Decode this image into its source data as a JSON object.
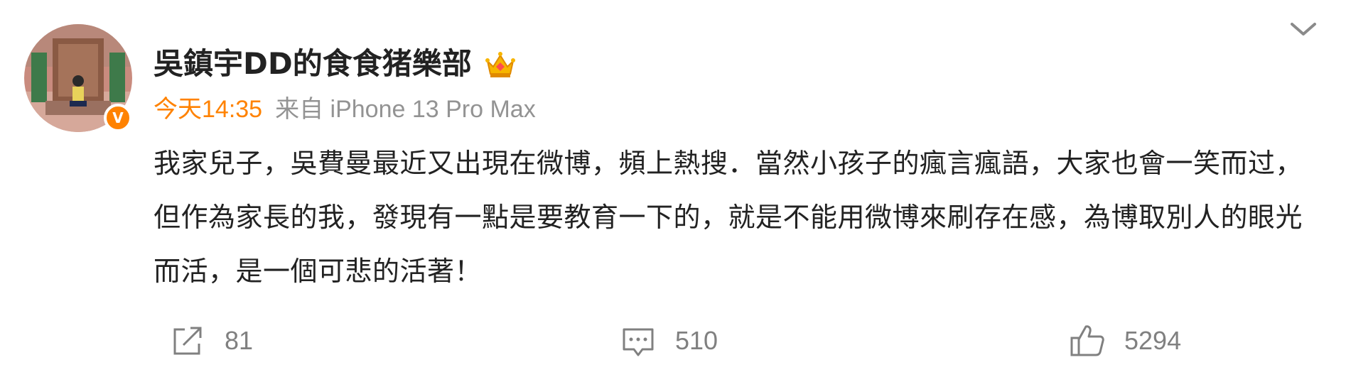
{
  "post": {
    "username": "吳鎮宇DD的食食猪樂部",
    "time": "今天14:35",
    "source": "来自 iPhone 13 Pro Max",
    "content": "我家兒子，吳費曼最近又出現在微博，頻上熱搜．當然小孩子的瘋言瘋語，大家也會一笑而过，但作為家長的我，發現有一點是要教育一下的，就是不能用微博來刷存在感，為博取別人的眼光而活，是一個可悲的活著！",
    "verified_mark": "V"
  },
  "actions": {
    "repost_count": "81",
    "comment_count": "510",
    "like_count": "5294"
  },
  "icons": {
    "repost": "share-icon",
    "comment": "comment-icon",
    "like": "thumbs-up-icon",
    "expand": "chevron-down-icon",
    "crown": "crown-icon"
  },
  "colors": {
    "accent": "#ff8200",
    "meta_gray": "#939393",
    "text": "#222222",
    "icon_gray": "#808080"
  }
}
